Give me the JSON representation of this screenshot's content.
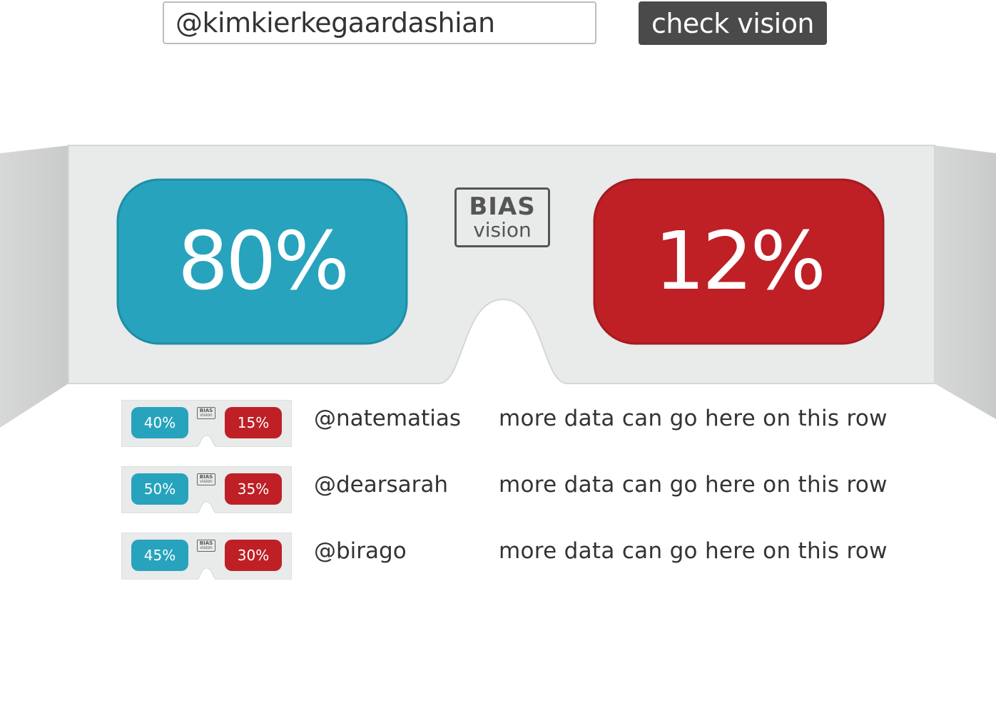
{
  "search": {
    "value": "@kimkierkegaardashian",
    "button_label": "check vision"
  },
  "colors": {
    "blue": "#27a3bd",
    "red": "#be2025",
    "frame": "#e9eaea",
    "button": "#4a4a4a"
  },
  "logo": {
    "line1": "BIAS",
    "line2": "vision"
  },
  "main_result": {
    "left_percent": "80%",
    "right_percent": "12%"
  },
  "rows": [
    {
      "left_percent": "40%",
      "right_percent": "15%",
      "user": "@natematias",
      "note": "more data can go here on this row"
    },
    {
      "left_percent": "50%",
      "right_percent": "35%",
      "user": "@dearsarah",
      "note": "more data can go here on this row"
    },
    {
      "left_percent": "45%",
      "right_percent": "30%",
      "user": "@birago",
      "note": "more data can go here on this row"
    }
  ]
}
